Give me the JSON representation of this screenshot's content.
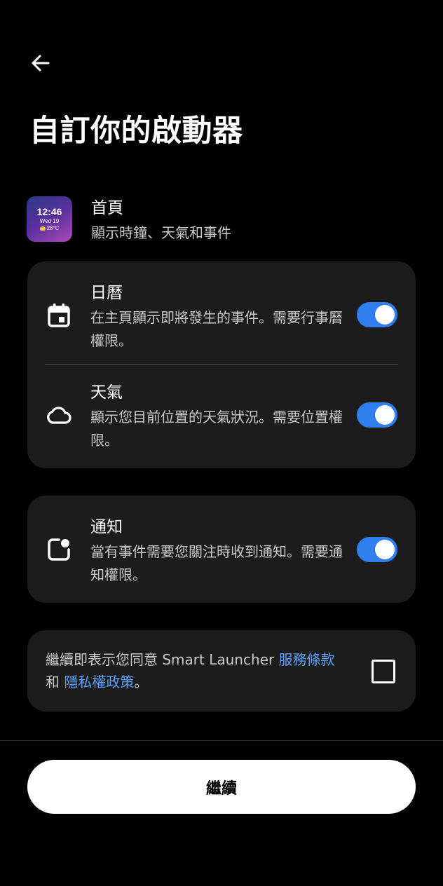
{
  "header": {
    "back_icon": "arrow-left-icon",
    "title": "自訂你的啟動器"
  },
  "home": {
    "title": "首頁",
    "subtitle": "顯示時鐘、天氣和事件",
    "widget": {
      "time": "12:46",
      "date": "Wed 19",
      "temperature": "28°C",
      "weather_icon": "partly-sunny-icon"
    }
  },
  "permissions": [
    {
      "icon": "calendar-icon",
      "title": "日曆",
      "description": "在主頁顯示即將發生的事件。需要行事曆權限。",
      "enabled": true
    },
    {
      "icon": "cloud-icon",
      "title": "天氣",
      "description": "顯示您目前位置的天氣狀況。需要位置權限。",
      "enabled": true
    }
  ],
  "notifications": {
    "icon": "notification-badge-icon",
    "title": "通知",
    "description": "當有事件需要您關注時收到通知。需要通知權限。",
    "enabled": true
  },
  "consent": {
    "text_prefix": "繼續即表示您同意 Smart Launcher ",
    "terms_link": "服務條款",
    "text_and": "和 ",
    "privacy_link": "隱私權政策",
    "text_suffix": "。",
    "checked": false
  },
  "footer": {
    "continue_label": "繼續"
  },
  "colors": {
    "background": "#000000",
    "card": "#1c1c1c",
    "accent": "#2f7ff0",
    "link": "#5aa2ff",
    "text_secondary": "#c9c9c9"
  }
}
